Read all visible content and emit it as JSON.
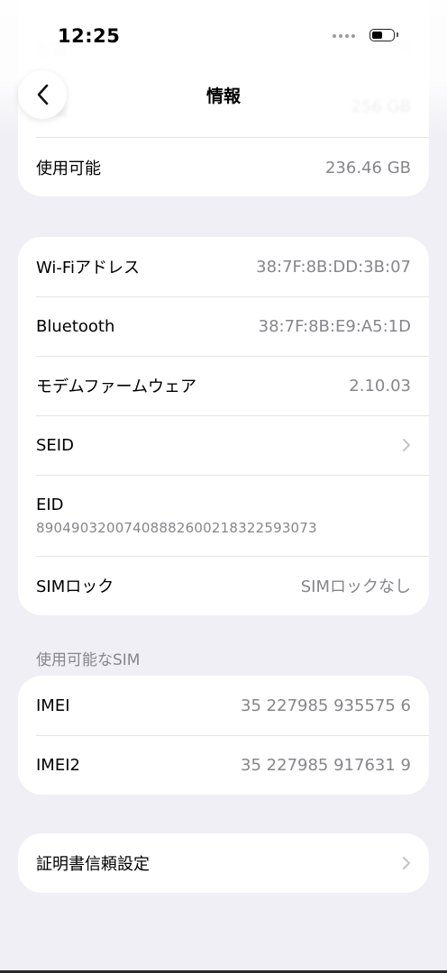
{
  "status_bar": {
    "time": "12:25"
  },
  "nav": {
    "title": "情報",
    "back_icon": "chevron-left-icon"
  },
  "top_card": {
    "rows": [
      {
        "label": "写真",
        "value": "0"
      },
      {
        "label": "容量",
        "value": "256 GB"
      },
      {
        "label": "使用可能",
        "value": "236.46 GB"
      }
    ]
  },
  "network_card": {
    "rows": [
      {
        "label": "Wi-Fiアドレス",
        "value": "38:7F:8B:DD:3B:07"
      },
      {
        "label": "Bluetooth",
        "value": "38:7F:8B:E9:A5:1D"
      },
      {
        "label": "モデムファームウェア",
        "value": "2.10.03"
      },
      {
        "label": "SEID",
        "value": ""
      },
      {
        "label": "EID",
        "value": "89049032007408882600218322593073"
      },
      {
        "label": "SIMロック",
        "value": "SIMロックなし"
      }
    ]
  },
  "sim_section": {
    "header": "使用可能なSIM",
    "rows": [
      {
        "label": "IMEI",
        "value": "35 227985 935575 6"
      },
      {
        "label": "IMEI2",
        "value": "35 227985 917631 9"
      }
    ]
  },
  "cert_card": {
    "label": "証明書信頼設定"
  },
  "colors": {
    "background": "#f0eff5",
    "card": "#ffffff",
    "secondary_text": "#86868b",
    "separator": "#e3e3e8"
  }
}
